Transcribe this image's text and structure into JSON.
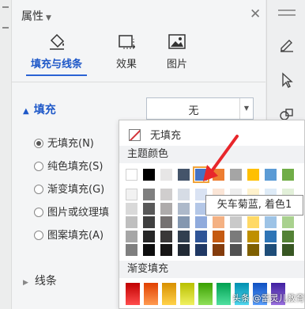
{
  "panel": {
    "title": "属性",
    "tabs": [
      {
        "label": "填充与线条",
        "icon": "fill-bucket-icon",
        "active": true
      },
      {
        "label": "效果",
        "icon": "effect-icon",
        "active": false
      },
      {
        "label": "图片",
        "icon": "image-icon",
        "active": false
      }
    ],
    "fill_section": "填充",
    "fill_dropdown_value": "无",
    "radio_options": [
      "无填充(N)",
      "纯色填充(S)",
      "渐变填充(G)",
      "图片或纹理填",
      "图案填充(A)"
    ],
    "selected_radio": 0,
    "line_section": "线条"
  },
  "popup": {
    "no_fill_label": "无填充",
    "theme_colors_label": "主题颜色",
    "gradient_label": "渐变填充",
    "tooltip": "矢车菊蓝, 着色1",
    "theme_row": [
      "#ffffff",
      "#000000",
      "#e7e6e6",
      "#44546a",
      "#4472c4",
      "#ed7d31",
      "#a5a5a5",
      "#ffc000",
      "#5b9bd5",
      "#70ad47"
    ],
    "shade_rows": [
      [
        "#f2f2f2",
        "#7f7f7f",
        "#d0cece",
        "#d6dce5",
        "#dae3f3",
        "#fbe5d6",
        "#ededed",
        "#fff2cc",
        "#deebf7",
        "#e2f0d9"
      ],
      [
        "#d9d9d9",
        "#595959",
        "#aeabab",
        "#adb9ca",
        "#b4c7e7",
        "#f8cbad",
        "#dbdbdb",
        "#ffe699",
        "#bdd7ee",
        "#c5e0b4"
      ],
      [
        "#bfbfbf",
        "#3f3f3f",
        "#757171",
        "#8497b0",
        "#8faadc",
        "#f4b183",
        "#c9c9c9",
        "#ffd966",
        "#9dc3e6",
        "#a9d18e"
      ],
      [
        "#a6a6a6",
        "#262626",
        "#3a3838",
        "#323f4f",
        "#2f5597",
        "#c55a11",
        "#7b7b7b",
        "#bf9000",
        "#2e75b6",
        "#548235"
      ],
      [
        "#7f7f7f",
        "#0d0d0d",
        "#171616",
        "#222a35",
        "#203864",
        "#843c0c",
        "#525252",
        "#7f6000",
        "#1f4e79",
        "#385723"
      ]
    ],
    "gradient_row": [
      [
        "#c00000",
        "#ff4d4d"
      ],
      [
        "#e04000",
        "#ff9a50"
      ],
      [
        "#d89000",
        "#ffd24a"
      ],
      [
        "#b8c000",
        "#f0f060"
      ],
      [
        "#3aa000",
        "#8fe05a"
      ],
      [
        "#00a050",
        "#50e0a0"
      ],
      [
        "#0090b0",
        "#50d8f0"
      ],
      [
        "#1050c0",
        "#5aa0ff"
      ],
      [
        "#4020a0",
        "#9a70e0"
      ]
    ],
    "selected_swatch_index": 4
  },
  "watermark": "头条 @雷灵儿教育"
}
